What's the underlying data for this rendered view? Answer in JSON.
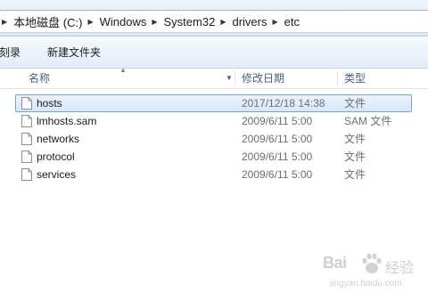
{
  "breadcrumb": [
    "本地磁盘 (C:)",
    "Windows",
    "System32",
    "drivers",
    "etc"
  ],
  "toolbar": {
    "cut_label": "刻录",
    "new_folder_label": "新建文件夹"
  },
  "columns": {
    "name": "名称",
    "date": "修改日期",
    "type": "类型"
  },
  "files": [
    {
      "name": "hosts",
      "date": "2017/12/18 14:38",
      "type": "文件",
      "selected": true
    },
    {
      "name": "lmhosts.sam",
      "date": "2009/6/11 5:00",
      "type": "SAM 文件",
      "selected": false
    },
    {
      "name": "networks",
      "date": "2009/6/11 5:00",
      "type": "文件",
      "selected": false
    },
    {
      "name": "protocol",
      "date": "2009/6/11 5:00",
      "type": "文件",
      "selected": false
    },
    {
      "name": "services",
      "date": "2009/6/11 5:00",
      "type": "文件",
      "selected": false
    }
  ],
  "watermark": {
    "logo": "Bai",
    "suffix": "经验",
    "url": "jingyan.baidu.com"
  },
  "icons": {
    "file": "file-icon",
    "separator": "chevron-right-icon",
    "sort": "sort-arrow-icon",
    "dropdown": "chevron-down-icon"
  },
  "colors": {
    "selection": "#d6e8fb",
    "selection_border": "#7da2ce",
    "header_text": "#4c607a"
  }
}
